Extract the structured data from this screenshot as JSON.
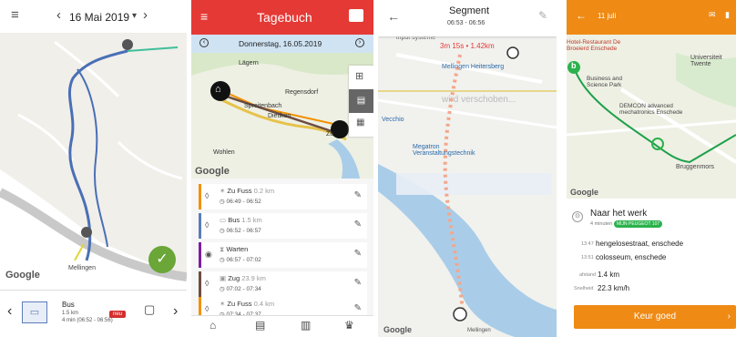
{
  "panel1": {
    "date_label": "16 Mai 2019",
    "dropdown_glyph": "▾",
    "prev_glyph": "‹",
    "next_glyph": "›",
    "transport": {
      "title": "Bus",
      "distance": "1.5 km",
      "duration": "4 min (06:52 - 06:56)",
      "badge": "neu"
    },
    "map_labels": [
      "Mellingen"
    ],
    "google": "Google",
    "icons": [
      "menu-icon",
      "bus-icon",
      "comment-icon",
      "check-icon"
    ]
  },
  "panel2": {
    "title": "Tagebuch",
    "date": "Donnerstag, 16.05.2019",
    "map_labels": [
      "Lägern",
      "Regensdorf",
      "Spreitenbach",
      "Dietikon",
      "Wohlen",
      "Zü"
    ],
    "google": "Google",
    "entries": [
      {
        "mode": "Zu Fuss",
        "distance": "0.2 km",
        "time": "06:49 - 06:52",
        "color": "#f29100",
        "icon": "walk-icon"
      },
      {
        "mode": "Bus",
        "distance": "1.5 km",
        "time": "06:52 - 06:57",
        "color": "#5c7cb8",
        "icon": "bus-icon"
      },
      {
        "mode": "Warten",
        "distance": "",
        "time": "06:57 - 07:02",
        "color": "#7b1fa2",
        "icon": "hourglass-icon"
      },
      {
        "mode": "Zug",
        "distance": "23.9 km",
        "time": "07:02 - 07:34",
        "color": "#6d4c41",
        "icon": "train-icon"
      },
      {
        "mode": "Zu Fuss",
        "distance": "0.4 km",
        "time": "07:34 - 07:37",
        "color": "#f29100",
        "icon": "walk-icon"
      }
    ],
    "nav": [
      "home-icon",
      "list-icon",
      "stats-icon",
      "trophy-icon"
    ]
  },
  "panel3": {
    "title": "Segment",
    "time_range": "06:53 - 06:56",
    "stats": "3m 15s • 1.42km",
    "map_labels": [
      "Mellingen Heitersberg",
      "Megatron Veranstaltungstechnik",
      "Mellingen",
      "Vecchio",
      "input systeme"
    ],
    "overlay": "wird verschoben...",
    "google": "Google"
  },
  "panel4": {
    "date": "11 juli",
    "map_labels": [
      "Hotel-Restaurant De Broeierd Enschede",
      "Universiteit Twente",
      "Business and Science Park",
      "DEMCON advanced mechatronics Enschede",
      "Bruggenmors"
    ],
    "marker_label": "b",
    "trip_title": "Naar het werk",
    "trip_meta": "4 minuten",
    "vehicle_tag": "MIJN PEUGEOT 107",
    "stop1_time": "13:47",
    "stop1": "hengelosestraat, enschede",
    "stop2_time": "13:51",
    "stop2": "colosseum, enschede",
    "distance_label": "afstand",
    "distance": "1.4 km",
    "speed_label": "Snelheid",
    "speed": "22.3 km/h",
    "approve": "Keur goed",
    "google": "Google"
  },
  "colors": {
    "red": "#e53935",
    "orange": "#ef8a14",
    "green": "#2bb24c",
    "blue_route": "#4a6fb5"
  }
}
